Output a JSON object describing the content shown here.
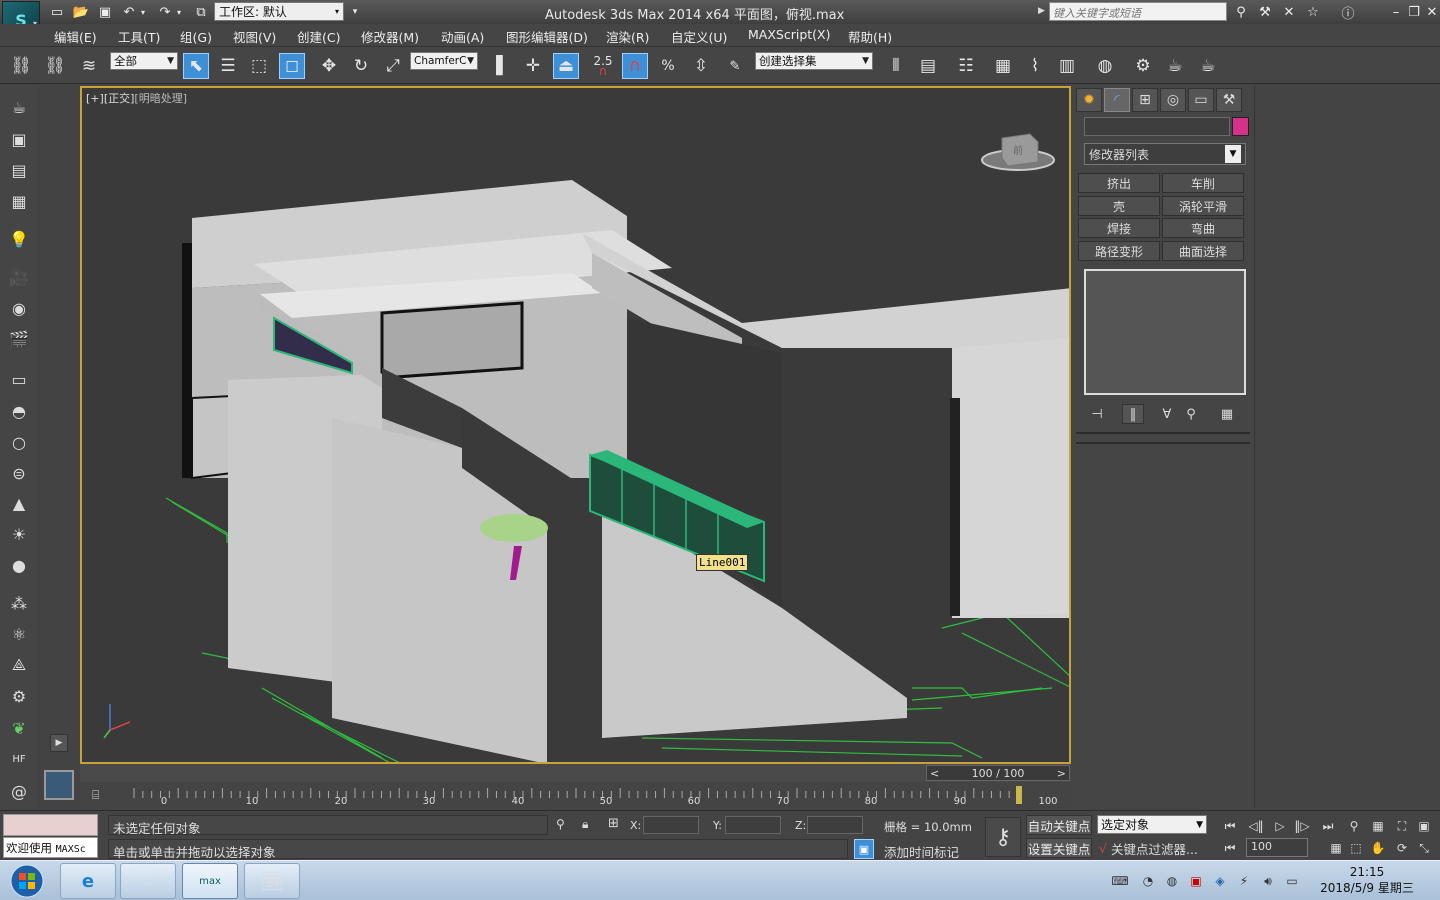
{
  "titlebar": {
    "workspace_label": "工作区: 默认",
    "window_title": "Autodesk 3ds Max  2014 x64      平面图，俯视.max",
    "search_placeholder": "键入关键字或短语"
  },
  "menu": {
    "items": [
      "编辑(E)",
      "工具(T)",
      "组(G)",
      "视图(V)",
      "创建(C)",
      "修改器(M)",
      "动画(A)",
      "图形编辑器(D)",
      "渲染(R)",
      "自定义(U)",
      "MAXScript(X)",
      "帮助(H)"
    ]
  },
  "toolbar": {
    "selection_filter": "全部",
    "ref_coord": "ChamferC",
    "snap_angle": "2.5",
    "named_selection": "创建选择集"
  },
  "viewport": {
    "label_bracket": "[+]",
    "label_view": "[正交]",
    "label_shading": "[明暗处理]",
    "selected_object_label": "Line001",
    "viewcube_face": "前"
  },
  "time_slider": {
    "frame_display": "100 / 100",
    "prev": "<",
    "next": ">"
  },
  "trackbar": {
    "ticks": [
      "0",
      "10",
      "20",
      "30",
      "40",
      "50",
      "60",
      "70",
      "80",
      "90",
      "100"
    ]
  },
  "command_panel": {
    "modifier_list": "修改器列表",
    "buttons": [
      "挤出",
      "车削",
      "壳",
      "涡轮平滑",
      "焊接",
      "弯曲",
      "路径变形",
      "曲面选择"
    ]
  },
  "status": {
    "maxscript_welcome": "欢迎使用",
    "maxscript_tag": "MAXSc",
    "line1": "未选定任何对象",
    "line2": "单击或单击并拖动以选择对象",
    "x_label": "X:",
    "y_label": "Y:",
    "z_label": "Z:",
    "grid": "栅格 = 10.0mm",
    "add_time_tag": "添加时间标记",
    "auto_key": "自动关键点",
    "set_key": "设置关键点",
    "selected_object": "选定对象",
    "key_filters": "关键点过滤器...",
    "current_frame": "100"
  },
  "taskbar": {
    "time": "21:15",
    "date": "2018/5/9 星期三",
    "max_task_label": "max"
  },
  "colors": {
    "accent_blue": "#3d8fd6",
    "viewport_border": "#c9a33a",
    "object_color": "#d4318a",
    "selected_green": "#2bb67a"
  }
}
